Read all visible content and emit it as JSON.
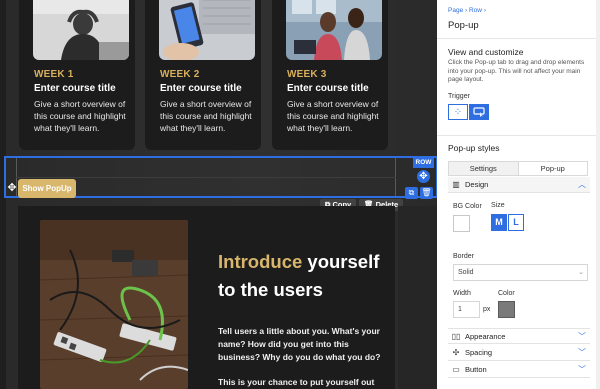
{
  "cards": [
    {
      "week": "WEEK 1",
      "title": "Enter course title",
      "desc": "Give a short overview of this course and highlight what they'll learn."
    },
    {
      "week": "WEEK 2",
      "title": "Enter course title",
      "desc": "Give a short overview of this course and highlight what they'll learn."
    },
    {
      "week": "WEEK 3",
      "title": "Enter course title",
      "desc": "Give a short overview of this course and highlight what they'll learn."
    }
  ],
  "row_toolbar": {
    "badge": "ROW",
    "copy": "Copy",
    "delete": "Delete"
  },
  "show_popup_label": "Show PopUp",
  "intro": {
    "title_accent": "Introduce",
    "title_rest": " yourself to the users",
    "body1": "Tell users a little about you. What's your name? How did you get into this business? Why do you do what you do?",
    "body2": "This is your chance to put yourself out there"
  },
  "panel": {
    "breadcrumb": [
      "Page",
      "Row"
    ],
    "title": "Pop-up",
    "view_title": "View and customize",
    "view_desc": "Click the Pop-up tab to drag and drop elements into your pop-up. This will not affect your main page layout.",
    "trigger_label": "Trigger",
    "styles_title": "Pop-up styles",
    "tabs": [
      "Settings",
      "Pop-up"
    ],
    "design_label": "Design",
    "bg_color_label": "BG Color",
    "size_label": "Size",
    "size_options": [
      "M",
      "L"
    ],
    "border_label": "Border",
    "border_value": "Solid",
    "width_label": "Width",
    "width_value": "1",
    "width_unit": "px",
    "color_label": "Color",
    "accordions": [
      "Appearance",
      "Spacing",
      "Button"
    ]
  },
  "colors": {
    "accent_blue": "#2f6ee0",
    "gold": "#d8b66c",
    "border_color_swatch": "#7a7a7a"
  }
}
